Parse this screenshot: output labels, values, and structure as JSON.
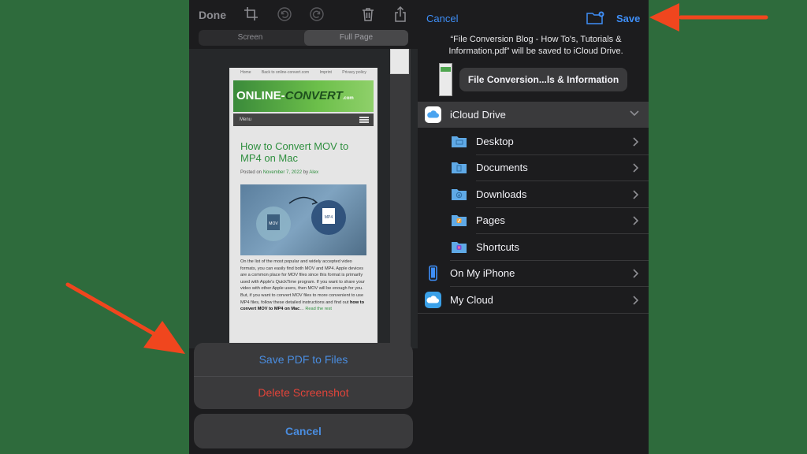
{
  "colors": {
    "background_green": "#2e6b3c",
    "panel_dark": "#1c1c1e",
    "ios_blue": "#3e8ef7",
    "destructive_red": "#e0443a",
    "annotation_arrow": "#f0461e"
  },
  "left": {
    "toolbar": {
      "done_label": "Done",
      "icons": [
        "crop-icon",
        "undo-icon",
        "redo-icon",
        "trash-icon",
        "share-icon"
      ]
    },
    "segments": {
      "screen": "Screen",
      "full_page": "Full Page",
      "selected": "Full Page"
    },
    "doc": {
      "top_links": [
        "Home",
        "Back to online-convert.com",
        "Imprint",
        "Privacy policy"
      ],
      "logo_main": "ONLINE-",
      "logo_accent": "CONVERT",
      "logo_suffix": ".com",
      "menu_label": "Menu",
      "title": "How to Convert MOV to MP4 on Mac",
      "posted_prefix": "Posted on ",
      "posted_date": "November 7, 2022",
      "posted_by": " by ",
      "posted_author": "Alex",
      "image_labels": {
        "left_file": "MOV",
        "right_file": "MP4"
      },
      "body_text": "On the list of the most popular and widely accepted video formats, you can easily find both MOV and MP4. Apple devices are a common place for MOV files since this format is primarily used with Apple's QuickTime program. If you want to share your video with other Apple users, then MOV will be enough for you. But, if you want to convert MOV files to more convenient to use MP4 files, follow these detailed instructions and find out ",
      "body_bold": "how to convert MOV to MP4 on Mac",
      "body_ellipsis": "… ",
      "read_rest": "Read the rest"
    },
    "actions": {
      "save_pdf": "Save PDF to Files",
      "delete": "Delete Screenshot",
      "cancel": "Cancel"
    }
  },
  "right": {
    "cancel_label": "Cancel",
    "save_label": "Save",
    "message": "“File Conversion Blog - How To's, Tutorials & Information.pdf” will be saved to iCloud Drive.",
    "filename_field": "File Conversion...ls & Information",
    "locations": [
      {
        "label": "iCloud Drive",
        "icon": "icloud-icon",
        "level": 0,
        "expanded": true
      },
      {
        "label": "Desktop",
        "icon": "folder-desktop-icon",
        "level": 1
      },
      {
        "label": "Documents",
        "icon": "folder-documents-icon",
        "level": 1
      },
      {
        "label": "Downloads",
        "icon": "folder-downloads-icon",
        "level": 1
      },
      {
        "label": "Pages",
        "icon": "folder-pages-icon",
        "level": 1
      },
      {
        "label": "Shortcuts",
        "icon": "folder-shortcuts-icon",
        "level": 1
      },
      {
        "label": "On My iPhone",
        "icon": "iphone-icon",
        "level": 0
      },
      {
        "label": "My Cloud",
        "icon": "my-cloud-icon",
        "level": 0
      }
    ]
  }
}
